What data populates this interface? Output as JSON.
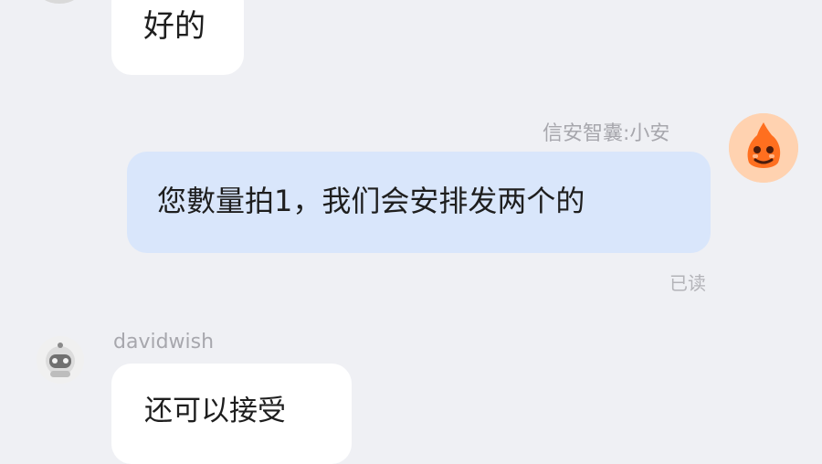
{
  "messages": [
    {
      "direction": "incoming",
      "text": "好的"
    },
    {
      "direction": "outgoing",
      "sender": "信安智囊:小安",
      "text": "您數量拍1，我们会安排发两个的",
      "status": "已读",
      "avatar_icon": "orange-mascot-icon"
    },
    {
      "direction": "incoming",
      "sender": "davidwish",
      "text": "还可以接受",
      "avatar_icon": "astronaut-icon"
    }
  ],
  "colors": {
    "background": "#eff0f4",
    "incoming_bubble": "#ffffff",
    "outgoing_bubble": "#d9e6fb",
    "meta_text": "#a7a7ad"
  }
}
